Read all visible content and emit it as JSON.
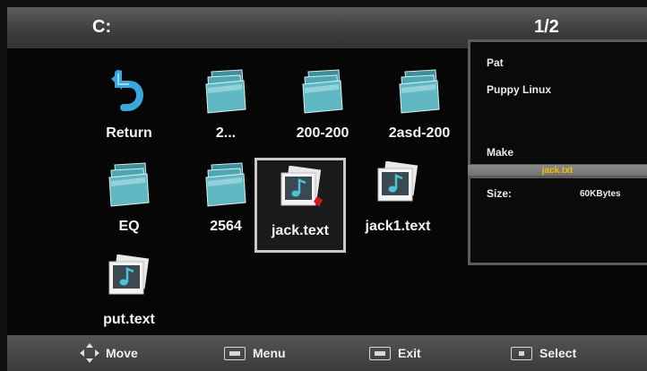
{
  "header": {
    "drive": "C:",
    "page": "1/2"
  },
  "items": [
    {
      "label": "Return",
      "icon": "return-arrow-icon"
    },
    {
      "label": "2...",
      "icon": "folder-icon"
    },
    {
      "label": "200-200",
      "icon": "folder-icon"
    },
    {
      "label": "2asd-200",
      "icon": "folder-icon"
    },
    {
      "label": "EQ",
      "icon": "folder-icon"
    },
    {
      "label": "2564",
      "icon": "folder-icon"
    },
    {
      "label": "jack.text",
      "icon": "music-file-icon",
      "selected": true
    },
    {
      "label": "jack1.text",
      "icon": "music-file-icon"
    },
    {
      "label": "put.text",
      "icon": "music-file-icon"
    }
  ],
  "info": {
    "line1": "Pat",
    "line2": "Puppy Linux",
    "line3": "Make",
    "filename": "jack.txt",
    "size_label": "Size:",
    "size_value": "60KBytes"
  },
  "footer": {
    "move": "Move",
    "menu": "Menu",
    "exit": "Exit",
    "select": "Select"
  },
  "colors": {
    "folder": "#5fb8c2",
    "accent_filename": "#f0c000"
  }
}
